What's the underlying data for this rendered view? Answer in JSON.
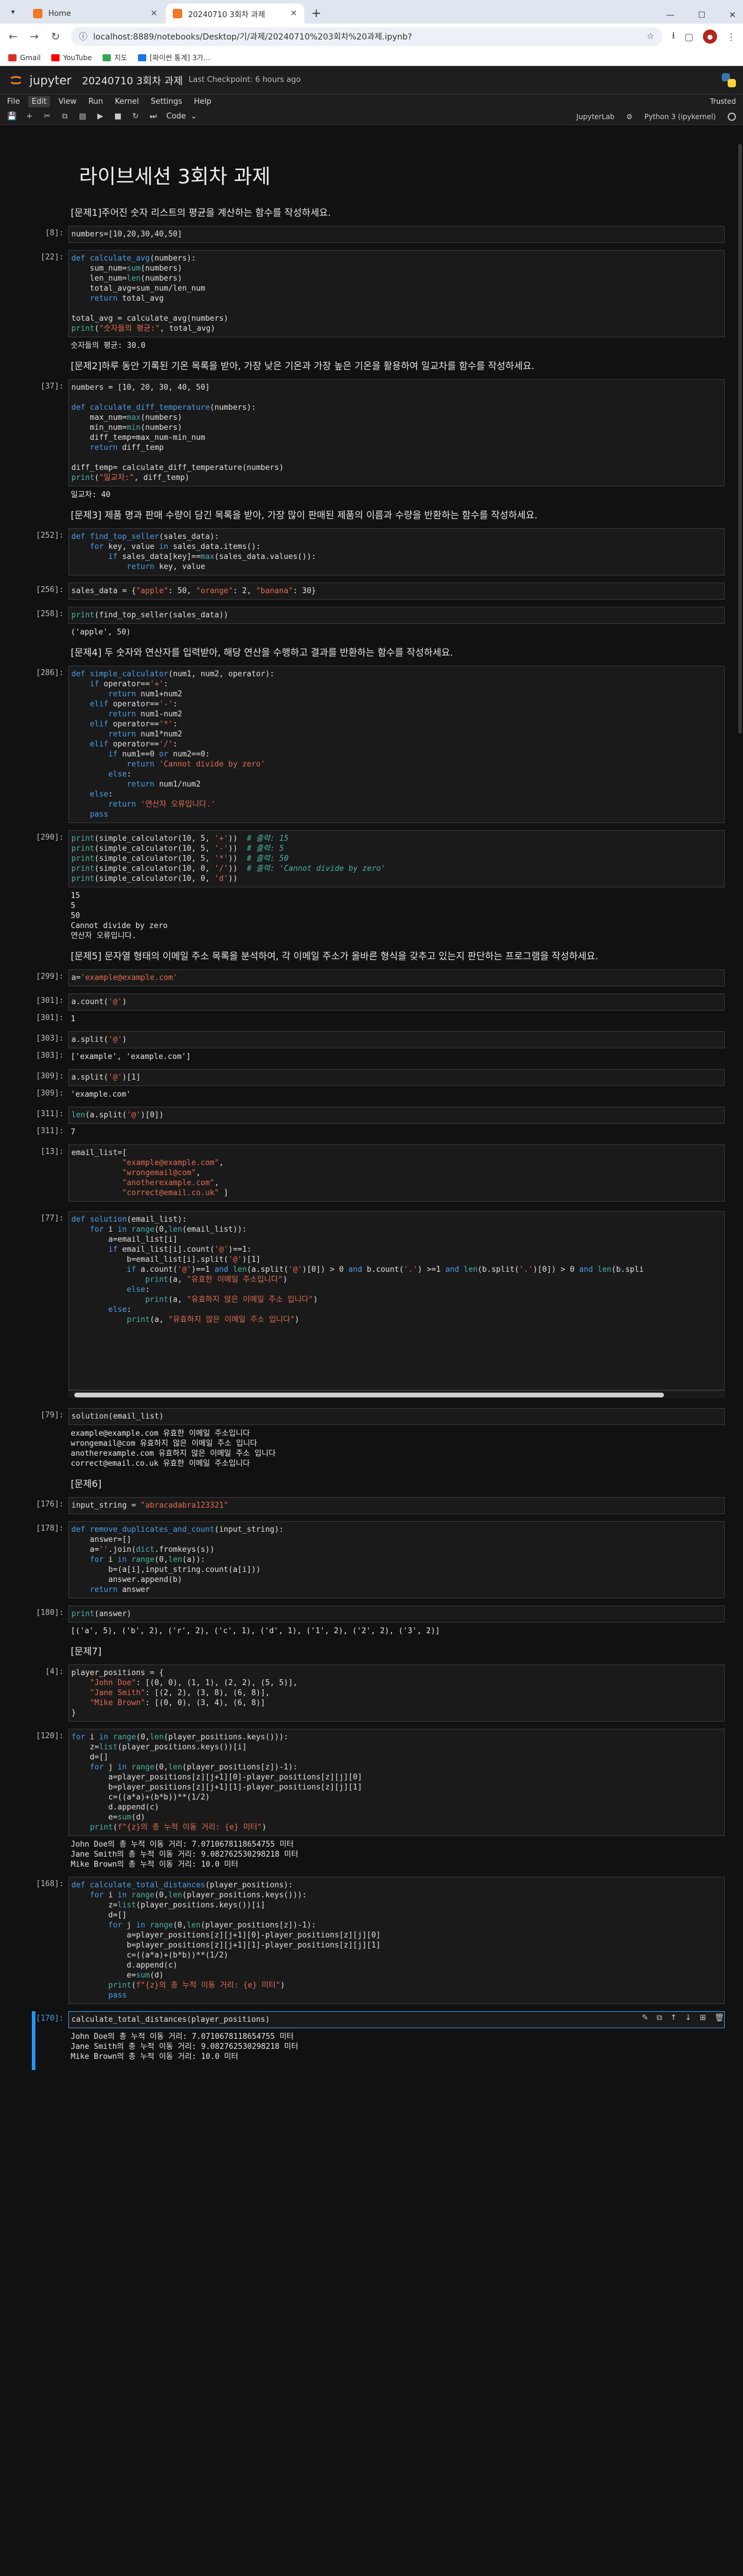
{
  "browser": {
    "tabs": [
      {
        "title": "Home",
        "active": false
      },
      {
        "title": "20240710 3회차 과제",
        "active": true
      }
    ],
    "url": "localhost:8889/notebooks/Desktop/기/과제/20240710%203회차%20과제.ipynb?",
    "bookmarks": [
      "Gmail",
      "YouTube",
      "지도",
      "[파이썬 통계] 3가..."
    ]
  },
  "jupyter": {
    "brand": "jupyter",
    "notebook_name": "20240710 3회차 과제",
    "checkpoint": "Last Checkpoint: 6 hours ago",
    "menu": [
      "File",
      "Edit",
      "View",
      "Run",
      "Kernel",
      "Settings",
      "Help"
    ],
    "trusted": "Trusted",
    "cell_type": "Code",
    "right_label": "JupyterLab",
    "kernel": "Python 3 (ipykernel)"
  },
  "cells": {
    "title": "라이브세션 3회차 과제",
    "q1": "[문제1]주어진 숫자 리스트의 평균을 계산하는 함수를 작성하세요.",
    "p8": "[8]:",
    "p22": "[22]:",
    "out22": "숫자들의 평균: 30.0",
    "q2": "[문제2]하루 동안 기록된 기온 목록을 받아, 가장 낮은 기온과 가장 높은 기온을 활용하여 일교차를 함수를 작성하세요.",
    "p37": "[37]:",
    "out37": "일교차: 40",
    "q3": "[문제3] 제품 명과 판매 수량이 담긴 목록을 받아, 가장 많이 판매된 제품의 이름과 수량을 반환하는 함수를 작성하세요.",
    "p252": "[252]:",
    "p256": "[256]:",
    "p258": "[258]:",
    "out258": "('apple', 50)",
    "q4": "[문제4] 두 숫자와 연산자를 입력받아, 해당 연산을 수행하고 결과를 반환하는 함수를 작성하세요.",
    "p286": "[286]:",
    "p290": "[290]:",
    "out290": "15\n5\n50\nCannot divide by zero\n연산자 오류입니다.",
    "q5": "[문제5] 문자열 형태의 이메일 주소 목록을 분석하여, 각 이메일 주소가 올바른 형식을 갖추고 있는지 판단하는 프로그램을 작성하세요.",
    "p299": "[299]:",
    "p301a": "[301]:",
    "p301b": "[301]:",
    "out301": "1",
    "p303a": "[303]:",
    "p303b": "[303]:",
    "out303": "['example', 'example.com']",
    "p309a": "[309]:",
    "p309b": "[309]:",
    "out309": "'example.com'",
    "p311a": "[311]:",
    "p311b": "[311]:",
    "out311": "7",
    "p13": "[13]:",
    "p77": "[77]:",
    "p79": "[79]:",
    "out79": "example@example.com 유효한 이메일 주소입니다\nwrongemail@com 유효하지 않은 이메일 주소 입니다\nanotherexample.com 유효하지 않은 이메일 주소 입니다\ncorrect@email.co.uk 유효한 이메일 주소입니다",
    "q6": "[문제6]",
    "p176": "[176]:",
    "p178": "[178]:",
    "p180": "[180]:",
    "out180": "[('a', 5), ('b', 2), ('r', 2), ('c', 1), ('d', 1), ('1', 2), ('2', 2), ('3', 2)]",
    "q7": "[문제7]",
    "p4": "[4]:",
    "p120": "[120]:",
    "out120": "John Doe의 총 누적 이동 거리: 7.0710678118654755 미터\nJane Smith의 총 누적 이동 거리: 9.082762530298218 미터\nMike Brown의 총 누적 이동 거리: 10.0 미터",
    "p168": "[168]:",
    "p170": "[170]:",
    "out170": "John Doe의 총 누적 이동 거리: 7.0710678118654755 미터\nJane Smith의 총 누적 이동 거리: 9.082762530298218 미터\nMike Brown의 총 누적 이동 거리: 10.0 미터"
  }
}
